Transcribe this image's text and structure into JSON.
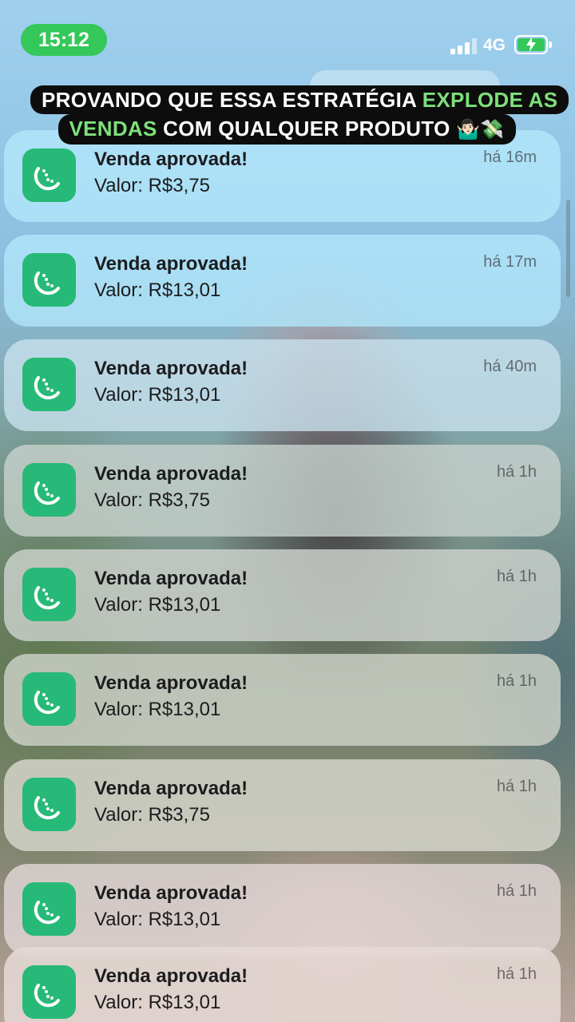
{
  "status_bar": {
    "time": "15:12",
    "network": "4G",
    "time_pill_color": "#34c759",
    "battery_color": "#34c759"
  },
  "caption": {
    "part1": "PROVANDO QUE ESSA ESTRATÉGIA ",
    "highlight1": "EXPLODE AS",
    "highlight2": "VENDAS",
    "part2": " COM QUALQUER PRODUTO ",
    "emoji": "🤷🏻‍♂️💸",
    "highlight_color": "#7ee07a"
  },
  "app": {
    "icon": "lime-slice-icon",
    "brand_color": "#27b977"
  },
  "notifications": [
    {
      "title": "Venda aprovada!",
      "body": "Valor: R$3,75",
      "time": "há 16m"
    },
    {
      "title": "Venda aprovada!",
      "body": "Valor: R$13,01",
      "time": "há 17m"
    },
    {
      "title": "Venda aprovada!",
      "body": "Valor: R$13,01",
      "time": "há 40m"
    },
    {
      "title": "Venda aprovada!",
      "body": "Valor: R$3,75",
      "time": "há 1h"
    },
    {
      "title": "Venda aprovada!",
      "body": "Valor: R$13,01",
      "time": "há 1h"
    },
    {
      "title": "Venda aprovada!",
      "body": "Valor: R$13,01",
      "time": "há 1h"
    },
    {
      "title": "Venda aprovada!",
      "body": "Valor: R$3,75",
      "time": "há 1h"
    },
    {
      "title": "Venda aprovada!",
      "body": "Valor: R$13,01",
      "time": "há 1h"
    },
    {
      "title": "Venda aprovada!",
      "body": "Valor: R$13,01",
      "time": "há 1h"
    }
  ]
}
